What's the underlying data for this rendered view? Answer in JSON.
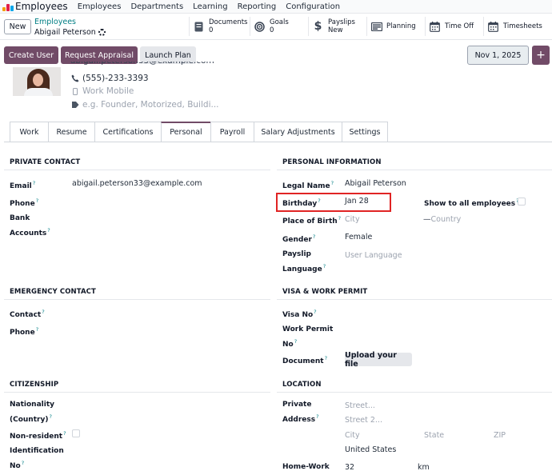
{
  "navbar": {
    "brand": "Employees",
    "menus": [
      "Employees",
      "Departments",
      "Learning",
      "Reporting",
      "Configuration"
    ]
  },
  "control_panel": {
    "new_label": "New",
    "breadcrumb_parent": "Employees",
    "breadcrumb_current": "Abigail Peterson",
    "smart_buttons": [
      {
        "label": "Documents",
        "value": "0",
        "icon": "documents-icon"
      },
      {
        "label": "Goals",
        "value": "0",
        "icon": "goals-icon"
      },
      {
        "label": "Payslips",
        "value": "New",
        "icon": "dollar-icon"
      },
      {
        "label": "Planning",
        "value": "",
        "icon": "planning-icon"
      },
      {
        "label": "Time Off",
        "value": "",
        "icon": "calendar-icon"
      },
      {
        "label": "Timesheets",
        "value": "",
        "icon": "calendar-icon"
      }
    ]
  },
  "toolbar": {
    "create_user": "Create User",
    "request_appraisal": "Request Appraisal",
    "launch_plan": "Launch Plan",
    "date": "Nov 1, 2025",
    "plus": "+"
  },
  "employee": {
    "email_partial": "abigail.peterson33@example.com",
    "phone": "(555)-233-3393",
    "work_mobile_placeholder": "Work Mobile",
    "tags_placeholder": "e.g. Founder, Motorized, Buildi..."
  },
  "tabs": [
    "Work",
    "Resume",
    "Certifications",
    "Personal",
    "Payroll",
    "Salary Adjustments",
    "Settings"
  ],
  "private_contact": {
    "title": "PRIVATE CONTACT",
    "email_label": "Email",
    "email_value": "abigail.peterson33@example.com",
    "phone_label": "Phone",
    "bank_label_1": "Bank",
    "bank_label_2": "Accounts"
  },
  "personal_info": {
    "title": "PERSONAL INFORMATION",
    "legal_name_label": "Legal Name",
    "legal_name_value": "Abigail Peterson",
    "birthday_label": "Birthday",
    "birthday_value": "Jan 28",
    "show_all_label": "Show to all employees",
    "place_label": "Place of Birth",
    "city_placeholder": "City",
    "country_placeholder": "Country",
    "gender_label": "Gender",
    "gender_value": "Female",
    "payslip_label_1": "Payslip",
    "payslip_label_2": "Language",
    "payslip_placeholder": "User Language"
  },
  "emergency": {
    "title": "EMERGENCY CONTACT",
    "contact_label": "Contact",
    "phone_label": "Phone"
  },
  "visa": {
    "title": "VISA & WORK PERMIT",
    "visa_label": "Visa No",
    "permit_label_1": "Work Permit",
    "permit_label_2": "No",
    "document_label": "Document",
    "upload_label": "Upload your file"
  },
  "citizenship": {
    "title": "CITIZENSHIP",
    "nationality_1": "Nationality",
    "nationality_2": "(Country)",
    "nonresident_label": "Non-resident",
    "identification_1": "Identification",
    "identification_2": "No"
  },
  "location": {
    "title": "LOCATION",
    "private_1": "Private",
    "private_2": "Address",
    "street_placeholder": "Street...",
    "street2_placeholder": "Street 2...",
    "city_placeholder": "City",
    "state_placeholder": "State",
    "zip_placeholder": "ZIP",
    "country_value": "United States",
    "home_work_label": "Home-Work",
    "home_work_value": "32",
    "home_work_unit": "km"
  },
  "colors": {
    "primary": "#714b67",
    "link": "#017e84",
    "highlight": "#e02424"
  }
}
